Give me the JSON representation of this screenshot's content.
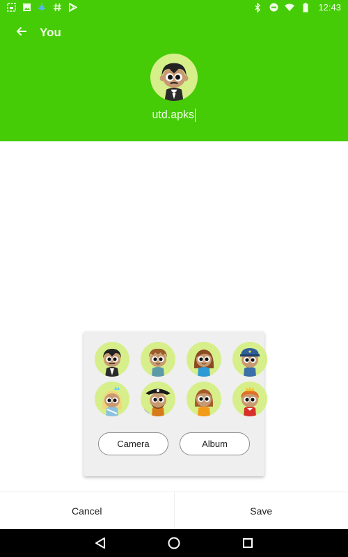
{
  "status_bar": {
    "left_icons": [
      "screenshot-icon",
      "image-icon",
      "download-icon",
      "hashtag-icon",
      "play-store-icon"
    ],
    "right_icons": [
      "bluetooth-icon",
      "do-not-disturb-icon",
      "wifi-icon",
      "battery-icon"
    ],
    "time": "12:43"
  },
  "toolbar": {
    "back_icon": "arrow-left-icon",
    "title": "You"
  },
  "profile": {
    "avatar": "vampire-avatar",
    "username": "utd.apks"
  },
  "avatar_picker": {
    "avatars": [
      {
        "name": "vampire"
      },
      {
        "name": "boy-brown-hair"
      },
      {
        "name": "girl-long-hair"
      },
      {
        "name": "police-officer"
      },
      {
        "name": "princess-blue"
      },
      {
        "name": "pirate"
      },
      {
        "name": "girl-orange"
      },
      {
        "name": "prince-red"
      }
    ],
    "camera_label": "Camera",
    "album_label": "Album"
  },
  "actions": {
    "cancel_label": "Cancel",
    "save_label": "Save"
  },
  "nav_bar": {
    "back": "back-triangle-icon",
    "home": "home-circle-icon",
    "recents": "recents-square-icon"
  },
  "colors": {
    "header_green": "#45cc06",
    "avatar_bg": "#d7ef8a"
  }
}
